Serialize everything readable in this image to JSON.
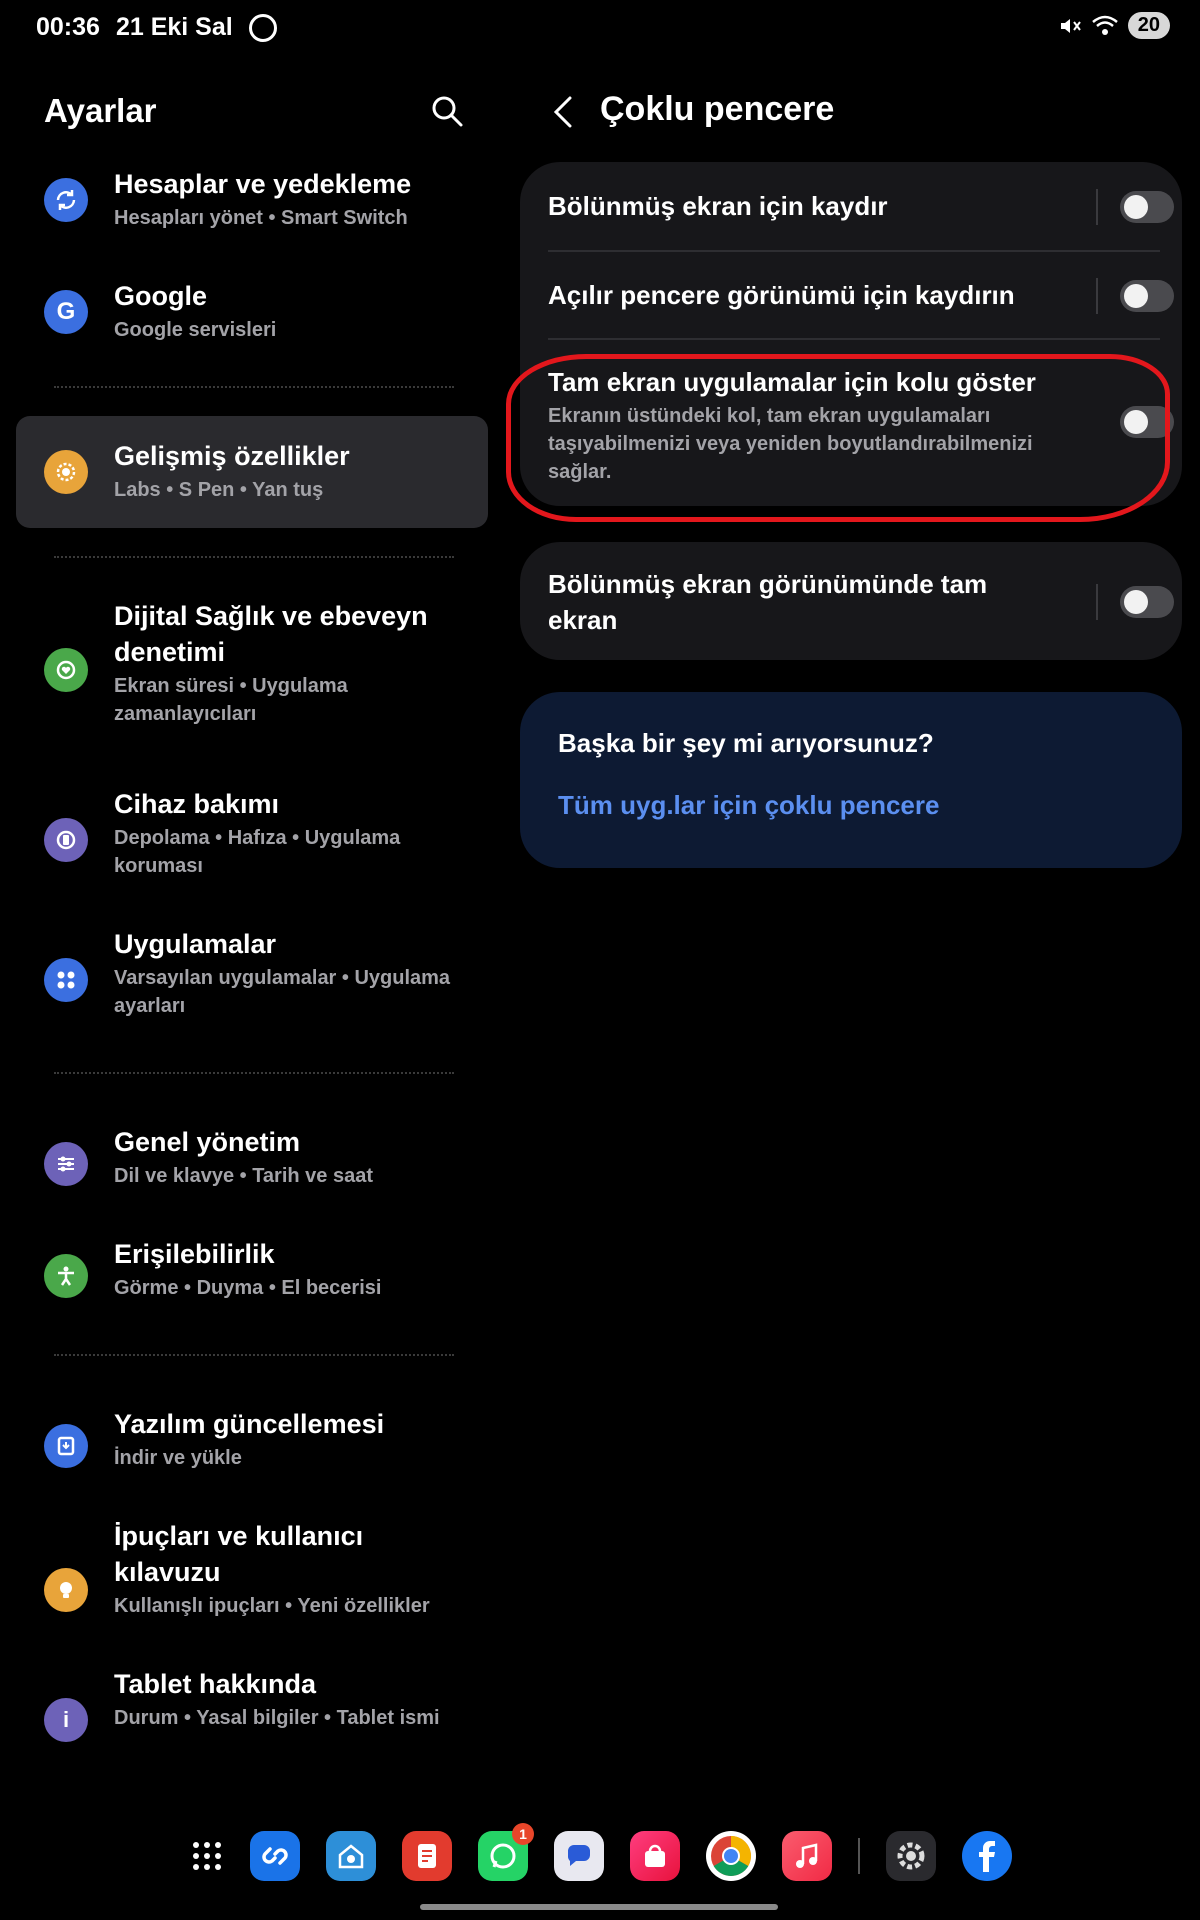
{
  "status_bar": {
    "time": "00:36",
    "date": "21 Eki Sal",
    "battery": "20"
  },
  "left": {
    "title": "Ayarlar",
    "items": [
      {
        "title": "Hesaplar ve yedekleme",
        "sub": "Hesapları yönet  •  Smart Switch",
        "icon": "sync-icon",
        "color": "#3b6fe0"
      },
      {
        "title": "Google",
        "sub": "Google servisleri",
        "icon": "google-icon",
        "color": "#3b6fe0"
      },
      {
        "title": "Gelişmiş özellikler",
        "sub": "Labs  •  S Pen  •  Yan tuş",
        "icon": "advanced-features-icon",
        "color": "#e8a43a"
      },
      {
        "title": "Dijital Sağlık ve ebeveyn denetimi",
        "sub": "Ekran süresi  •  Uygulama zamanlayıcıları",
        "icon": "wellbeing-icon",
        "color": "#4aa84a"
      },
      {
        "title": "Cihaz bakımı",
        "sub": "Depolama  •  Hafıza  •  Uygulama koruması",
        "icon": "device-care-icon",
        "color": "#6d62b8"
      },
      {
        "title": "Uygulamalar",
        "sub": "Varsayılan uygulamalar  •  Uygulama ayarları",
        "icon": "apps-icon",
        "color": "#3b6fe0"
      },
      {
        "title": "Genel yönetim",
        "sub": "Dil ve klavye  •  Tarih ve saat",
        "icon": "general-management-icon",
        "color": "#6d62b8"
      },
      {
        "title": "Erişilebilirlik",
        "sub": "Görme  •  Duyma  •  El becerisi",
        "icon": "accessibility-icon",
        "color": "#4aa84a"
      },
      {
        "title": "Yazılım güncellemesi",
        "sub": "İndir ve yükle",
        "icon": "software-update-icon",
        "color": "#3b6fe0"
      },
      {
        "title": "İpuçları ve kullanıcı kılavuzu",
        "sub": "Kullanışlı ipuçları  •  Yeni özellikler",
        "icon": "tips-icon",
        "color": "#e8a43a"
      },
      {
        "title": "Tablet hakkında",
        "sub": "Durum  •  Yasal bilgiler  •  Tablet ismi",
        "icon": "info-icon",
        "color": "#6d62b8"
      }
    ]
  },
  "right": {
    "title": "Çoklu pencere",
    "rows": [
      {
        "title": "Bölünmüş ekran için kaydır"
      },
      {
        "title": "Açılır pencere görünümü için kaydırın"
      },
      {
        "title": "Tam ekran uygulamalar için kolu göster",
        "desc": "Ekranın üstündeki kol, tam ekran uygulamaları taşıyabilmenizi veya yeniden boyutlandırabilmenizi sağlar."
      },
      {
        "title": "Bölünmüş ekran görünümünde tam ekran"
      }
    ],
    "search_card": {
      "title": "Başka bir şey mi arıyorsunuz?",
      "link": "Tüm uyg.lar için çoklu pencere"
    }
  },
  "dock": {
    "whatsapp_badge": "1"
  }
}
